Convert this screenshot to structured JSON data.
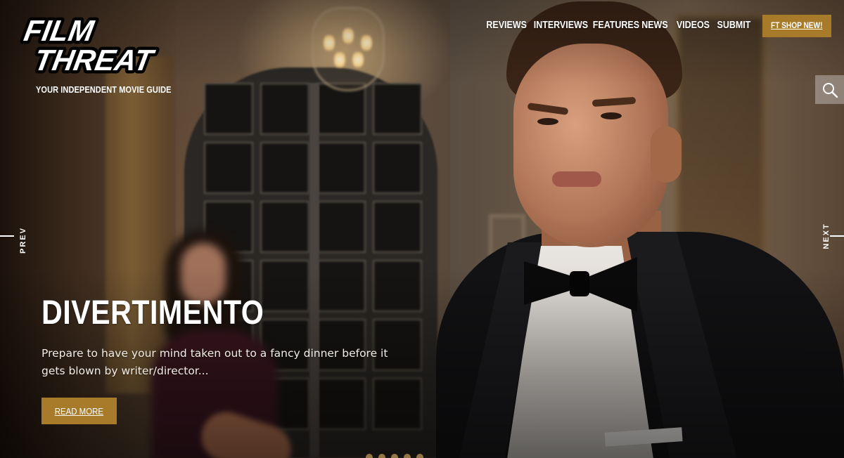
{
  "header": {
    "logo_text": "FILM THREAT",
    "tagline": "YOUR INDEPENDENT MOVIE GUIDE"
  },
  "nav": {
    "items": [
      {
        "label": "REVIEWS"
      },
      {
        "label": "INTERVIEWS"
      },
      {
        "label": "FEATURES"
      },
      {
        "label": "NEWS"
      },
      {
        "label": "VIDEOS"
      },
      {
        "label": "SUBMIT"
      }
    ],
    "shop_label": "FT SHOP NEW!"
  },
  "search": {
    "icon": "search-icon"
  },
  "slider": {
    "prev_label": "PREV",
    "next_label": "NEXT",
    "title": "DIVERTIMENTO",
    "excerpt": "Prepare to have your mind taken out to a fancy dinner before it gets blown by writer/director...",
    "cta_label": "READ MORE"
  },
  "colors": {
    "accent": "#a87b2a",
    "text": "#ffffff"
  }
}
